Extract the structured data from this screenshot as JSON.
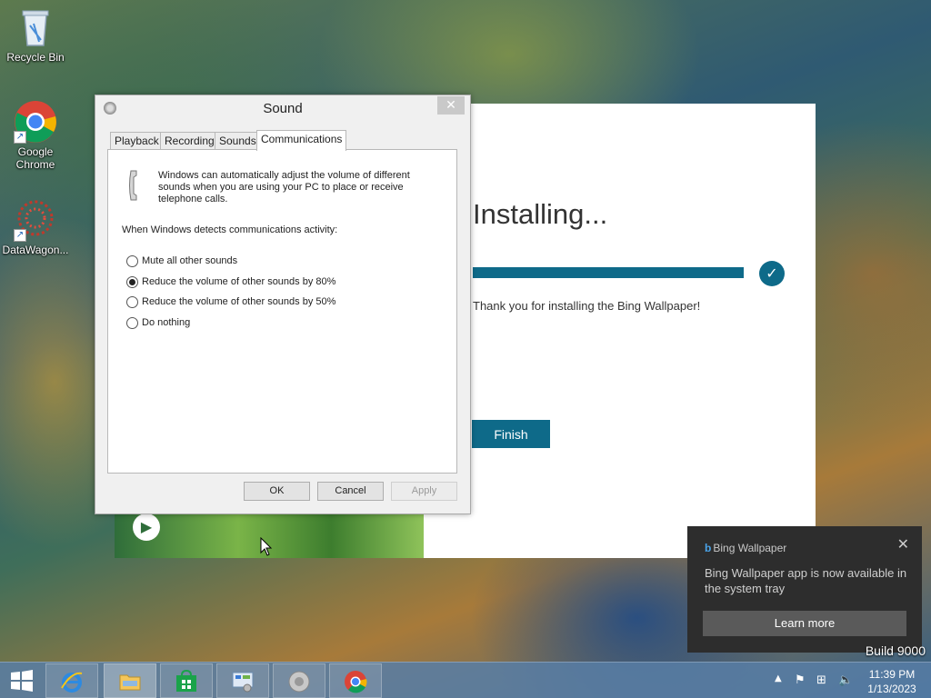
{
  "desktop": {
    "icons": [
      {
        "label": "Recycle Bin"
      },
      {
        "label": "Google Chrome"
      },
      {
        "label": "DataWagon..."
      }
    ]
  },
  "installer": {
    "title": "Installing...",
    "progress": 1.0,
    "message": "Thank you for installing the Bing Wallpaper!",
    "finish_label": "Finish",
    "accent": "#0e6a89"
  },
  "sound_dialog": {
    "title": "Sound",
    "close_glyph": "✕",
    "tabs": [
      "Playback",
      "Recording",
      "Sounds",
      "Communications"
    ],
    "active_tab": "Communications",
    "description": "Windows can automatically adjust the volume of different sounds when you are using your PC to place or receive telephone calls.",
    "lead": "When Windows detects communications activity:",
    "options": [
      {
        "label": "Mute all other sounds",
        "checked": false
      },
      {
        "label": "Reduce the volume of other sounds by 80%",
        "checked": true
      },
      {
        "label": "Reduce the volume of other sounds by 50%",
        "checked": false
      },
      {
        "label": "Do nothing",
        "checked": false
      }
    ],
    "buttons": {
      "ok": "OK",
      "cancel": "Cancel",
      "apply": "Apply"
    }
  },
  "toast": {
    "app_name": "Bing Wallpaper",
    "message": "Bing Wallpaper app is now available in the system tray",
    "button": "Learn more",
    "close_glyph": "✕"
  },
  "watermark": "Build 9000",
  "taskbar": {
    "apps": [
      "internet-explorer",
      "file-explorer",
      "store",
      "control-panel",
      "sound",
      "chrome"
    ],
    "clock": {
      "time": "11:39 PM",
      "date": "1/13/2023"
    }
  },
  "colors": {
    "taskbar": "#587ea6",
    "toast_bg": "#2d2d2d",
    "installer_accent": "#0e6a89"
  }
}
